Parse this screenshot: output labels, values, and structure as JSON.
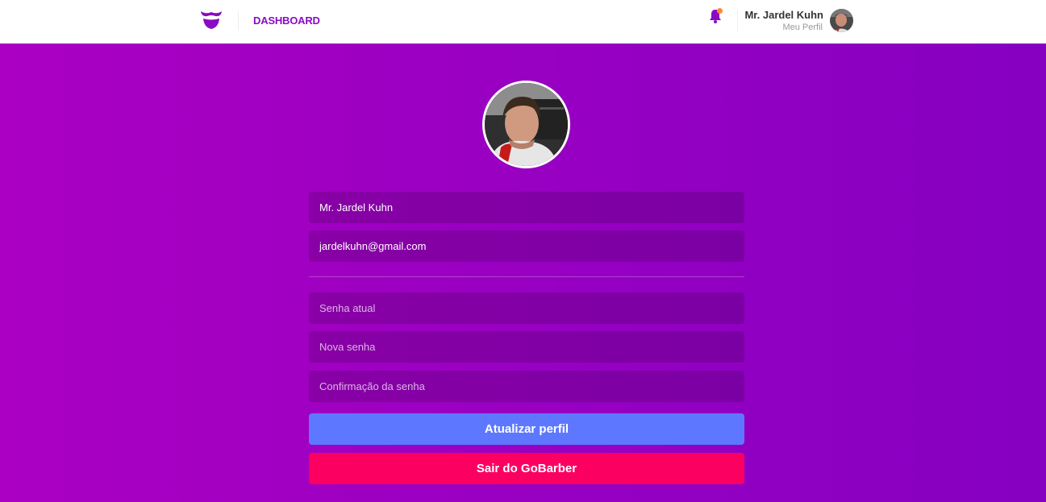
{
  "header": {
    "logo_icon": "mustache-logo-icon",
    "nav_dashboard": "DASHBOARD",
    "notifications_icon": "bell-icon",
    "profile_name": "Mr. Jardel Kuhn",
    "profile_link": "Meu Perfil",
    "colors": {
      "accent": "#8a0bc2",
      "badge": "#ff892e"
    }
  },
  "form": {
    "name_value": "Mr. Jardel Kuhn",
    "email_value": "jardelkuhn@gmail.com",
    "current_password_placeholder": "Senha atual",
    "new_password_placeholder": "Nova senha",
    "confirm_password_placeholder": "Confirmação da senha",
    "update_button": "Atualizar perfil",
    "logout_button": "Sair do GoBarber"
  },
  "colors": {
    "background_start": "#ab00c3",
    "background_end": "#8600c1",
    "update_button": "#5d78ff",
    "logout_button": "#fb0061"
  }
}
